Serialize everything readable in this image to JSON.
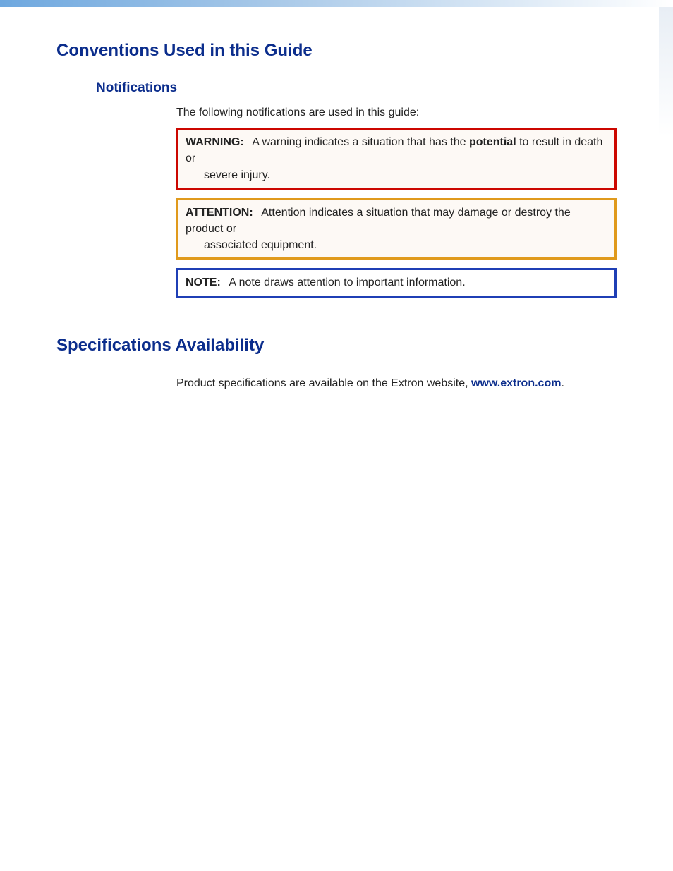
{
  "headings": {
    "main": "Conventions Used in this Guide",
    "notifications": "Notifications",
    "specs": "Specifications Availability"
  },
  "notifications_intro": "The following notifications are used in this guide:",
  "warning": {
    "label": "WARNING:",
    "text_before": "A warning indicates a situation that has the ",
    "text_bold": "potential",
    "text_after": " to result in death or",
    "text_line2": "severe injury."
  },
  "attention": {
    "label": "ATTENTION:",
    "text_line1": "Attention indicates a situation that may damage or destroy the product or",
    "text_line2": "associated equipment."
  },
  "note": {
    "label": "NOTE:",
    "text": "A note draws attention to important information."
  },
  "specs_body": {
    "text_before": "Product specifications are available on the Extron website, ",
    "link_text": "www.extron.com",
    "text_after": "."
  }
}
